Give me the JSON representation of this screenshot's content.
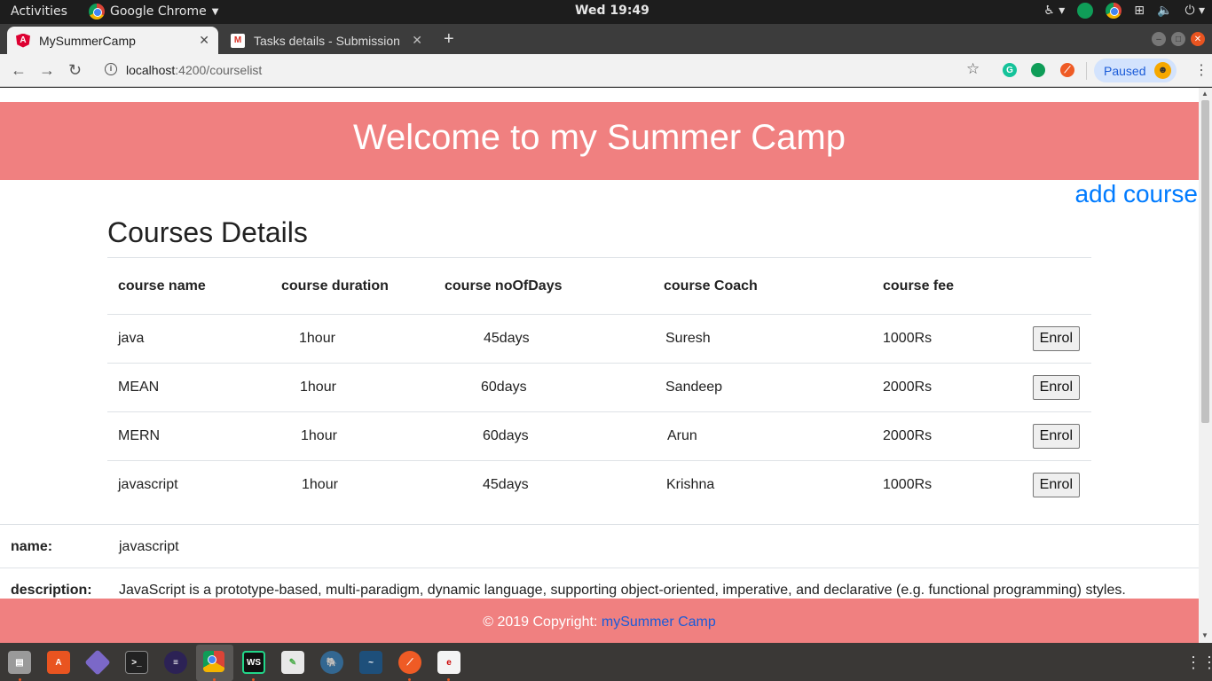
{
  "system": {
    "activities": "Activities",
    "app_menu": "Google Chrome",
    "clock": "Wed 19:49"
  },
  "browser": {
    "tabs": [
      {
        "title": "MySummerCamp",
        "active": true
      },
      {
        "title": "Tasks details - Submission",
        "active": false
      }
    ],
    "url_host": "localhost",
    "url_path": ":4200/courselist",
    "profile_button": "Paused"
  },
  "page": {
    "hero_title": "Welcome to my Summer Camp",
    "add_course_link": "add course",
    "section_title": "Courses Details",
    "table": {
      "headers": [
        "course name",
        "course duration",
        "course noOfDays",
        "course Coach",
        "course fee"
      ],
      "rows": [
        {
          "name": "java",
          "duration": "1hour",
          "days": "45days",
          "coach": "Suresh",
          "fee": "1000Rs",
          "action": "Enrol"
        },
        {
          "name": "MEAN",
          "duration": "1hour",
          "days": "60days",
          "coach": "Sandeep",
          "fee": "2000Rs",
          "action": "Enrol"
        },
        {
          "name": "MERN",
          "duration": "1hour",
          "days": "60days",
          "coach": "Arun",
          "fee": "2000Rs",
          "action": "Enrol"
        },
        {
          "name": "javascript",
          "duration": "1hour",
          "days": "45days",
          "coach": "Krishna",
          "fee": "1000Rs",
          "action": "Enrol"
        }
      ]
    },
    "details": {
      "name_label": "name:",
      "name_value": "javascript",
      "description_label": "description:",
      "description_value": "JavaScript is a prototype-based, multi-paradigm, dynamic language, supporting object-oriented, imperative, and declarative (e.g. functional programming) styles."
    },
    "footer": {
      "copyright": "© 2019 Copyright:",
      "link": "mySummer Camp"
    }
  },
  "colors": {
    "brand": "#f08080",
    "link": "#007bff"
  }
}
